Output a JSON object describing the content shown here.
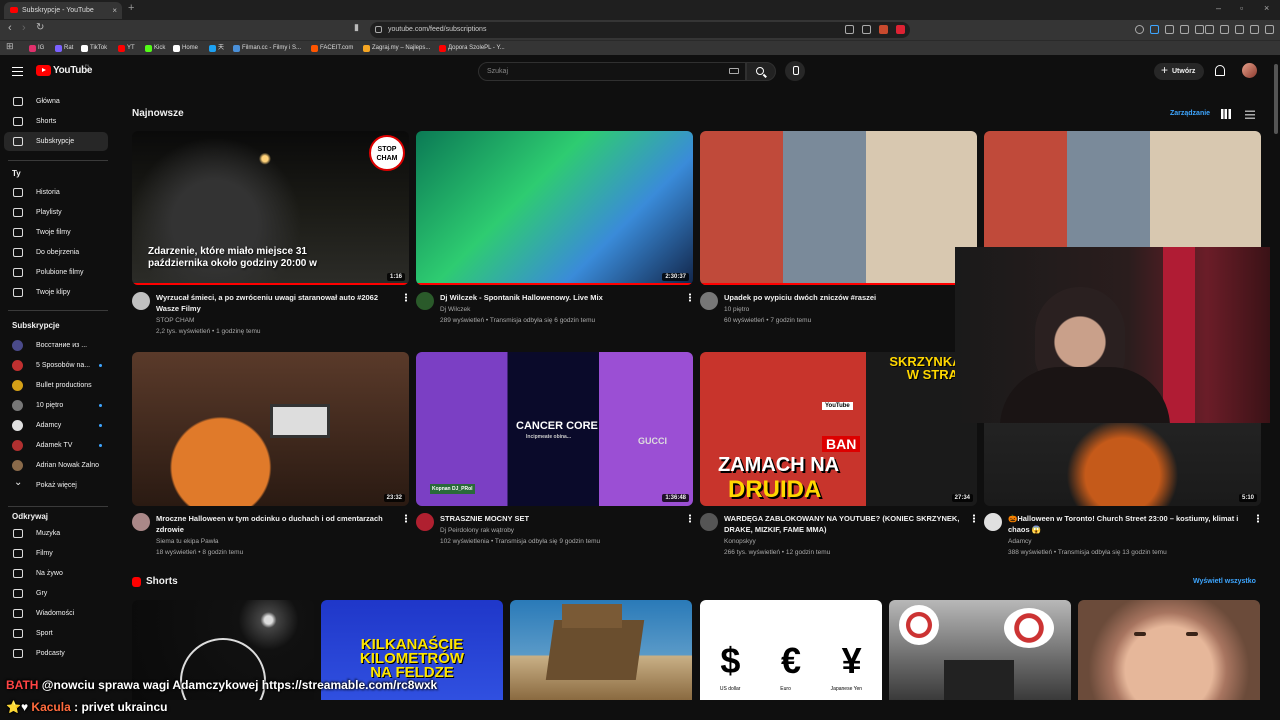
{
  "browser": {
    "tab_title": "Subskrypcje - YouTube",
    "url": "youtube.com/feed/subscriptions",
    "bookmarks": [
      {
        "label": "IG",
        "color": "#e1306c"
      },
      {
        "label": "Rat",
        "color": "#7b61ff"
      },
      {
        "label": "TikTok",
        "color": "#ffffff"
      },
      {
        "label": "YT",
        "color": "#ff0000"
      },
      {
        "label": "Kick",
        "color": "#53fc18"
      },
      {
        "label": "Home",
        "color": "#ffffff"
      },
      {
        "label": "天",
        "color": "#1da1f2"
      },
      {
        "label": "Filman.cc - Filmy i S...",
        "color": "#4a90d9"
      },
      {
        "label": "FACEIT.com",
        "color": "#ff5500"
      },
      {
        "label": "Zagraj.my – Najleps...",
        "color": "#f5a623"
      },
      {
        "label": "Доpora SzolePL - Y...",
        "color": "#ff0000"
      }
    ]
  },
  "header": {
    "logo_text": "YouTube",
    "country": "PL",
    "search_placeholder": "Szukaj",
    "create_label": "Utwórz"
  },
  "sidebar": {
    "main": [
      {
        "label": "Główna",
        "icon": "home-icon"
      },
      {
        "label": "Shorts",
        "icon": "shorts-icon"
      },
      {
        "label": "Subskrypcje",
        "icon": "subscriptions-icon",
        "active": true
      }
    ],
    "you_title": "Ty",
    "you": [
      {
        "label": "Historia",
        "icon": "history-icon"
      },
      {
        "label": "Playlisty",
        "icon": "playlist-icon"
      },
      {
        "label": "Twoje filmy",
        "icon": "video-icon"
      },
      {
        "label": "Do obejrzenia",
        "icon": "clock-icon"
      },
      {
        "label": "Polubione filmy",
        "icon": "like-icon"
      },
      {
        "label": "Twoje klipy",
        "icon": "scissors-icon"
      }
    ],
    "subs_title": "Subskrypcje",
    "subs": [
      {
        "label": "Восстание из ...",
        "color": "#4a4a8a",
        "dot": false
      },
      {
        "label": "5 Sposobów na...",
        "color": "#c03030",
        "dot": true
      },
      {
        "label": "Bullet productions",
        "color": "#d4a017",
        "dot": false
      },
      {
        "label": "10 piętro",
        "color": "#777777",
        "dot": true
      },
      {
        "label": "Adamcy",
        "color": "#e0e0e0",
        "dot": true
      },
      {
        "label": "Adamek TV",
        "color": "#b03030",
        "dot": true
      },
      {
        "label": "Adrian Nowak Zalno",
        "color": "#8a6a4a",
        "dot": false
      }
    ],
    "show_more": "Pokaż więcej",
    "explore_title": "Odkrywaj",
    "explore": [
      {
        "label": "Muzyka",
        "icon": "music-icon"
      },
      {
        "label": "Filmy",
        "icon": "film-icon"
      },
      {
        "label": "Na żywo",
        "icon": "live-icon"
      },
      {
        "label": "Gry",
        "icon": "gamepad-icon"
      },
      {
        "label": "Wiadomości",
        "icon": "news-icon"
      },
      {
        "label": "Sport",
        "icon": "trophy-icon"
      },
      {
        "label": "Podcasty",
        "icon": "podcast-icon"
      }
    ]
  },
  "main": {
    "section_title": "Najnowsze",
    "manage_label": "Zarządzanie",
    "videos": [
      {
        "title": "Wyrzucał śmieci, a po zwróceniu uwagi staranował auto #2062 Wasze Filmy",
        "channel": "STOP CHAM",
        "meta": "2,2 tys. wyświetleń • 1 godzinę temu",
        "duration": "1:16",
        "overlay": "Zdarzenie, które miało miejsce 31 października około godziny 20:00 w",
        "badge": "STOP CHAM",
        "av": "#c0c0c0",
        "progress": 1.0
      },
      {
        "title": "Dj Wilczek - Spontanik Hallowenowy. Live Mix",
        "channel": "Dj Wilczek",
        "meta": "289 wyświetleń • Transmisja odbyła się 6 godzin temu",
        "duration": "2:30:37",
        "av": "#2a5a2a",
        "progress": 1.0
      },
      {
        "title": "Upadek po wypiciu dwóch zniczów  #raszei",
        "channel": "10 piętro",
        "meta": "60 wyświetleń • 7 godzin temu",
        "duration": "",
        "av": "#777777",
        "progress": 1.0
      },
      {
        "title": "",
        "channel": "",
        "meta": "",
        "duration": "",
        "av": "",
        "progress": 0
      },
      {
        "title": "Mroczne Halloween w tym odcinku o duchach i od cmentarzach zdrowie",
        "channel": "Siema tu ekipa Pawła",
        "meta": "18 wyświetleń • 8 godzin temu",
        "duration": "23:32",
        "av": "#aa8888",
        "progress": 0
      },
      {
        "title": "STRASZNIE MOCNY SET",
        "channel": "Dj Peirdolony rak wątroby",
        "meta": "102 wyświetlenia • Transmisja odbyła się 9 godzin temu",
        "duration": "1:36:48",
        "av": "#b02030",
        "progress": 0
      },
      {
        "title": "WARDĘGA ZABLOKOWANY NA YOUTUBE? (KONIEC SKRZYNEK, DRAKE, MIZKIF, FAME MMA)",
        "channel": "Konopskyy",
        "meta": "266 tys. wyświetleń • 12 godzin temu",
        "duration": "27:34",
        "av": "#555555",
        "progress": 0
      },
      {
        "title": "🎃Halloween w Toronto! Church Street 23:00 – kostiumy, klimat i chaos 😱",
        "channel": "Adamcy",
        "meta": "388 wyświetleń • Transmisja odbyła się 13 godzin temu",
        "duration": "5:10",
        "av": "#e0e0e0",
        "progress": 0
      }
    ],
    "thumb_texts": {
      "zamach_top": "SKRZYNKAR",
      "zamach_top2": "W STRACI",
      "zamach_mid": "ZAMACH NA",
      "zamach_bot": "DRUIDA",
      "ban": "BAN",
      "youtube": "YouTube",
      "cancer": "CANCER CORE",
      "cancer_sub": "Incipmeate obina...",
      "gucci": "GUCCI",
      "kopnan": "Kopnan DJ_PRol"
    },
    "shorts_title": "Shorts",
    "show_all": "Wyświetl wszystko",
    "shorts_texts": {
      "kil1": "KILKANAŚCIE",
      "kil2": "KILOMETRÓW",
      "kil3": "NA FELDZE",
      "currency": [
        "$",
        "€",
        "¥"
      ],
      "currency_labels": [
        "US dollar",
        "Euro",
        "Japanese Yen"
      ]
    }
  },
  "overlay": {
    "chat1_user": "BATH",
    "chat1_text": "@nowciu sprawa wagi Adamczykowej https://streamable.com/rc8wxk",
    "chat2_user": "Kacula",
    "chat2_text": ": privet ukraincu"
  }
}
